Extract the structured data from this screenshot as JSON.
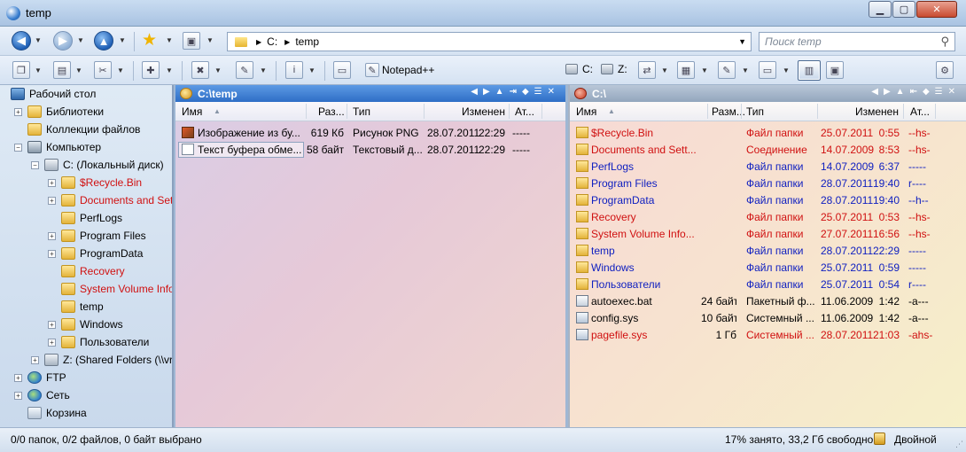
{
  "window": {
    "title": "temp"
  },
  "address": {
    "crumbs": [
      "C:",
      "temp"
    ]
  },
  "search": {
    "placeholder": "Поиск temp"
  },
  "toolbar": {
    "notepad_label": "Notepad++",
    "drive_c": "C:",
    "drive_z": "Z:"
  },
  "tree": {
    "items": [
      {
        "label": "Рабочий стол",
        "icon": "desktop-icon",
        "level": 0,
        "expander": "",
        "color": ""
      },
      {
        "label": "Библиотеки",
        "icon": "folder-icon",
        "level": 1,
        "expander": "+",
        "color": ""
      },
      {
        "label": "Коллекции файлов",
        "icon": "folder-icon",
        "level": 1,
        "expander": "",
        "color": ""
      },
      {
        "label": "Компьютер",
        "icon": "computer-icon",
        "level": 1,
        "expander": "−",
        "color": ""
      },
      {
        "label": "C: (Локальный диск)",
        "icon": "drive-icon",
        "level": 2,
        "expander": "−",
        "color": ""
      },
      {
        "label": "$Recycle.Bin",
        "icon": "folder-icon",
        "level": 3,
        "expander": "+",
        "color": "red"
      },
      {
        "label": "Documents and Set",
        "icon": "folder-icon",
        "level": 3,
        "expander": "+",
        "color": "red"
      },
      {
        "label": "PerfLogs",
        "icon": "folder-icon",
        "level": 3,
        "expander": "",
        "color": ""
      },
      {
        "label": "Program Files",
        "icon": "folder-icon",
        "level": 3,
        "expander": "+",
        "color": ""
      },
      {
        "label": "ProgramData",
        "icon": "folder-icon",
        "level": 3,
        "expander": "+",
        "color": ""
      },
      {
        "label": "Recovery",
        "icon": "folder-icon",
        "level": 3,
        "expander": "",
        "color": "red"
      },
      {
        "label": "System Volume Info",
        "icon": "folder-icon",
        "level": 3,
        "expander": "",
        "color": "red"
      },
      {
        "label": "temp",
        "icon": "folder-icon",
        "level": 3,
        "expander": "",
        "color": ""
      },
      {
        "label": "Windows",
        "icon": "folder-icon",
        "level": 3,
        "expander": "+",
        "color": ""
      },
      {
        "label": "Пользователи",
        "icon": "folder-icon",
        "level": 3,
        "expander": "+",
        "color": ""
      },
      {
        "label": "Z: (Shared Folders (\\\\vr",
        "icon": "network-drive-icon",
        "level": 2,
        "expander": "+",
        "color": ""
      },
      {
        "label": "FTP",
        "icon": "globe-icon",
        "level": 1,
        "expander": "+",
        "color": ""
      },
      {
        "label": "Сеть",
        "icon": "network-icon",
        "level": 1,
        "expander": "+",
        "color": ""
      },
      {
        "label": "Корзина",
        "icon": "recycle-bin-icon",
        "level": 1,
        "expander": "",
        "color": ""
      }
    ]
  },
  "left_panel": {
    "path": "C:\\temp",
    "columns": {
      "name": "Имя",
      "size": "Раз...",
      "type": "Тип",
      "modified": "Изменен",
      "attr": "Ат..."
    },
    "rows": [
      {
        "name": "Изображение из бу...",
        "size": "619 Кб",
        "type": "Рисунок PNG",
        "date": "28.07.2011",
        "time": "22:29",
        "attr": "-----",
        "icon": "png-file-icon",
        "color": ""
      },
      {
        "name": "Текст буфера обме...",
        "size": "58 байт",
        "type": "Текстовый д...",
        "date": "28.07.2011",
        "time": "22:29",
        "attr": "-----",
        "icon": "text-file-icon",
        "color": ""
      }
    ]
  },
  "right_panel": {
    "path": "C:\\",
    "columns": {
      "name": "Имя",
      "size": "Разм...",
      "type": "Тип",
      "modified": "Изменен",
      "attr": "Ат..."
    },
    "rows": [
      {
        "name": "$Recycle.Bin",
        "size": "",
        "type": "Файл папки",
        "date": "25.07.2011",
        "time": "0:55",
        "attr": "--hs-",
        "icon": "folder-icon",
        "color": "red"
      },
      {
        "name": "Documents and Sett...",
        "size": "",
        "type": "Соединение",
        "date": "14.07.2009",
        "time": "8:53",
        "attr": "--hs-",
        "icon": "folder-icon",
        "color": "red"
      },
      {
        "name": "PerfLogs",
        "size": "",
        "type": "Файл папки",
        "date": "14.07.2009",
        "time": "6:37",
        "attr": "-----",
        "icon": "folder-icon",
        "color": "blue"
      },
      {
        "name": "Program Files",
        "size": "",
        "type": "Файл папки",
        "date": "28.07.2011",
        "time": "19:40",
        "attr": "r----",
        "icon": "folder-icon",
        "color": "blue"
      },
      {
        "name": "ProgramData",
        "size": "",
        "type": "Файл папки",
        "date": "28.07.2011",
        "time": "19:40",
        "attr": "--h--",
        "icon": "folder-icon",
        "color": "blue"
      },
      {
        "name": "Recovery",
        "size": "",
        "type": "Файл папки",
        "date": "25.07.2011",
        "time": "0:53",
        "attr": "--hs-",
        "icon": "folder-icon",
        "color": "red"
      },
      {
        "name": "System Volume Info...",
        "size": "",
        "type": "Файл папки",
        "date": "27.07.2011",
        "time": "16:56",
        "attr": "--hs-",
        "icon": "folder-icon",
        "color": "red"
      },
      {
        "name": "temp",
        "size": "",
        "type": "Файл папки",
        "date": "28.07.2011",
        "time": "22:29",
        "attr": "-----",
        "icon": "folder-icon",
        "color": "blue"
      },
      {
        "name": "Windows",
        "size": "",
        "type": "Файл папки",
        "date": "25.07.2011",
        "time": "0:59",
        "attr": "-----",
        "icon": "folder-icon",
        "color": "blue"
      },
      {
        "name": "Пользователи",
        "size": "",
        "type": "Файл папки",
        "date": "25.07.2011",
        "time": "0:54",
        "attr": "r----",
        "icon": "folder-icon",
        "color": "blue"
      },
      {
        "name": "autoexec.bat",
        "size": "24 байт",
        "type": "Пакетный ф...",
        "date": "11.06.2009",
        "time": "1:42",
        "attr": "-a---",
        "icon": "bat-file-icon",
        "color": ""
      },
      {
        "name": "config.sys",
        "size": "10 байт",
        "type": "Системный ...",
        "date": "11.06.2009",
        "time": "1:42",
        "attr": "-a---",
        "icon": "sys-file-icon",
        "color": ""
      },
      {
        "name": "pagefile.sys",
        "size": "1 Гб",
        "type": "Системный ...",
        "date": "28.07.2011",
        "time": "21:03",
        "attr": "-ahs-",
        "icon": "sys-file-icon",
        "color": "red"
      }
    ]
  },
  "status": {
    "selection": "0/0 папок, 0/2 файлов, 0 байт выбрано",
    "disk": "17% занято, 33,2 Гб свободно",
    "mode": "Двойной"
  },
  "colors": {
    "hidden_red": "#d01010",
    "folder_blue": "#1020c0",
    "active_header": "#2e6ec6"
  }
}
